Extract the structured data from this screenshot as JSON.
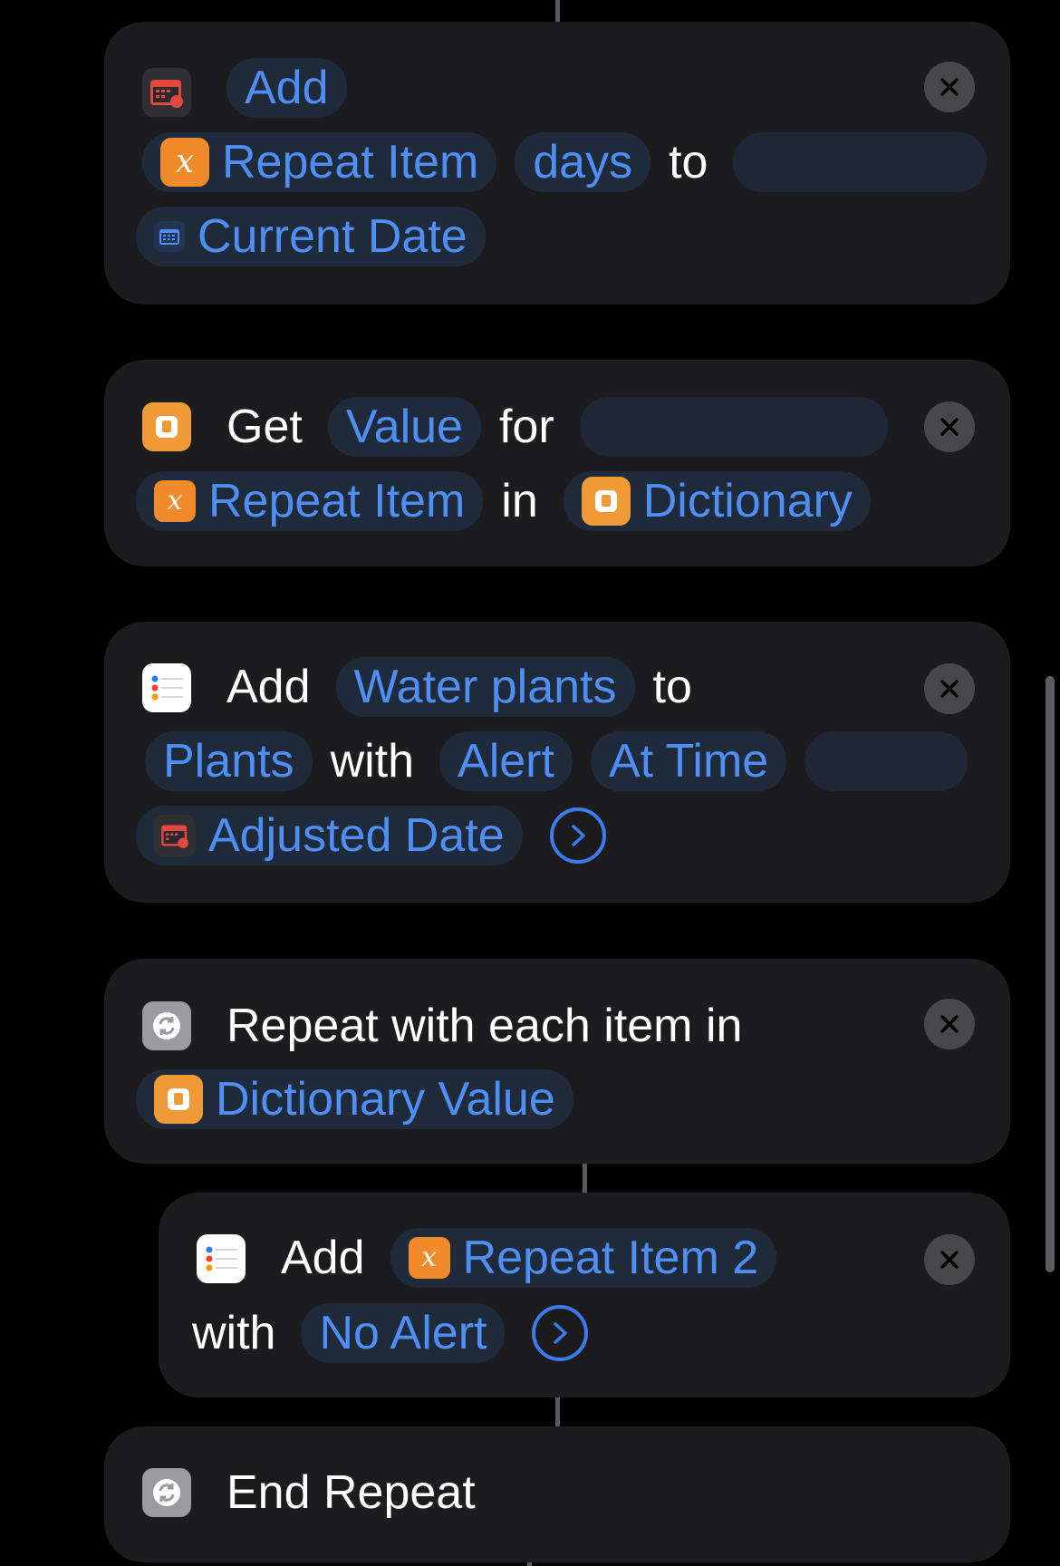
{
  "blocks": [
    {
      "id": "add-date",
      "icon": "calendar-icon",
      "lines": [
        [
          {
            "t": "pill",
            "text": "Add"
          }
        ],
        [
          {
            "t": "pill",
            "icon": "variable-icon",
            "text": "Repeat Item"
          },
          {
            "t": "pill",
            "text": "days"
          },
          {
            "t": "text",
            "text": "to"
          },
          {
            "t": "blank"
          }
        ],
        [
          {
            "t": "pill",
            "icon": "calendar-small-icon",
            "text": "Current Date"
          }
        ]
      ]
    },
    {
      "id": "get-dictionary-value",
      "icon": "dictionary-icon",
      "lines": [
        [
          {
            "t": "text",
            "text": "Get"
          },
          {
            "t": "pill",
            "text": "Value"
          },
          {
            "t": "text",
            "text": "for"
          },
          {
            "t": "blank"
          }
        ],
        [
          {
            "t": "pill",
            "icon": "variable-icon",
            "text": "Repeat Item"
          },
          {
            "t": "text",
            "text": "in"
          },
          {
            "t": "pill",
            "icon": "dictionary-icon",
            "text": "Dictionary"
          }
        ]
      ]
    },
    {
      "id": "add-reminder",
      "icon": "reminders-icon",
      "lines": [
        [
          {
            "t": "text",
            "text": "Add"
          },
          {
            "t": "pill",
            "text": "Water plants"
          },
          {
            "t": "text",
            "text": "to"
          }
        ],
        [
          {
            "t": "pill",
            "text": "Plants"
          },
          {
            "t": "text",
            "text": "with"
          },
          {
            "t": "pill",
            "text": "Alert"
          },
          {
            "t": "pill",
            "text": "At Time"
          },
          {
            "t": "blank"
          }
        ],
        [
          {
            "t": "pill",
            "icon": "calendar-small-icon",
            "text": "Adjusted Date"
          },
          {
            "t": "chevron"
          }
        ]
      ]
    },
    {
      "id": "repeat-each",
      "icon": "repeat-icon",
      "lines": [
        [
          {
            "t": "text",
            "text": "Repeat with each item in"
          }
        ],
        [
          {
            "t": "pill",
            "icon": "dictionary-icon",
            "text": "Dictionary Value"
          }
        ]
      ]
    },
    {
      "id": "add-reminder-2",
      "icon": "reminders-icon",
      "lines": [
        [
          {
            "t": "text",
            "text": "Add"
          },
          {
            "t": "pill",
            "icon": "variable-icon",
            "text": "Repeat Item 2"
          }
        ],
        [
          {
            "t": "text",
            "text": "with"
          },
          {
            "t": "pill",
            "text": "No Alert"
          },
          {
            "t": "chevron"
          }
        ]
      ]
    },
    {
      "id": "end-repeat",
      "icon": "repeat-icon",
      "lines": [
        [
          {
            "t": "text",
            "text": "End Repeat"
          }
        ]
      ]
    }
  ],
  "icons": {
    "variable-icon": "x",
    "dictionary-icon": "▯",
    "repeat-icon": "↻"
  }
}
